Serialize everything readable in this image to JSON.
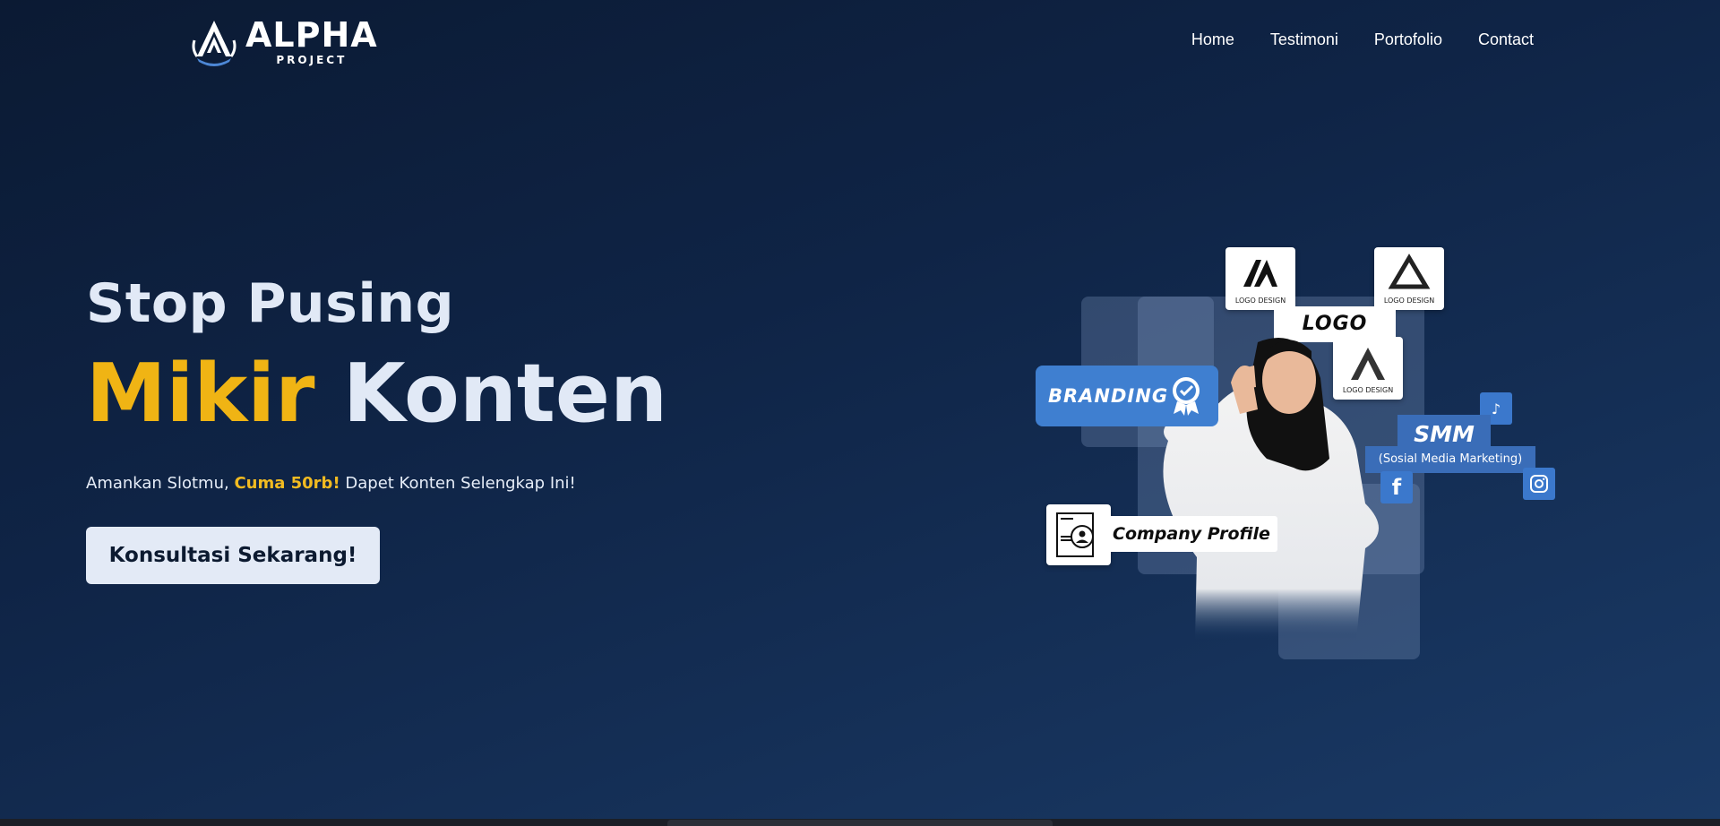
{
  "brand": {
    "name": "ALPHA",
    "tagline": "PROJECT"
  },
  "nav": {
    "items": [
      "Home",
      "Testimoni",
      "Portofolio",
      "Contact"
    ]
  },
  "hero": {
    "line1": "Stop Pusing",
    "line2_highlight": "Mikir",
    "line2_rest": "Konten",
    "sub_prefix": "Amankan Slotmu, ",
    "sub_price": "Cuma 50rb!",
    "sub_suffix": " Dapet Konten Selengkap Ini!",
    "cta_label": "Konsultasi Sekarang!"
  },
  "illustration": {
    "logo_tag": "LOGO",
    "logo_card_caption": "LOGO DESIGN",
    "branding_tag": "BRANDING",
    "smm_tag": "SMM",
    "smm_sub": "(Sosial Media Marketing)",
    "company_tag": "Company Profile"
  },
  "colors": {
    "accent_yellow": "#f0b414",
    "panel_blue": "#3f7fd0",
    "bg_dark": "#0b1a33"
  }
}
